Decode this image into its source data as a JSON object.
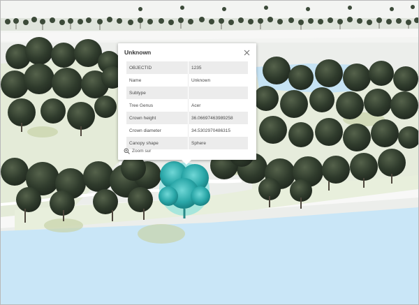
{
  "popup": {
    "title": "Unknown",
    "attributes": [
      {
        "field": "OBJECTID",
        "value": "1235"
      },
      {
        "field": "Name",
        "value": "Unknown"
      },
      {
        "field": "Subtype",
        "value": ""
      },
      {
        "field": "Tree Genus",
        "value": "Acer"
      },
      {
        "field": "Crown height",
        "value": "36.06697463989258"
      },
      {
        "field": "Crown diameter",
        "value": "34.5302970486315"
      },
      {
        "field": "Canopy shape",
        "value": "Sphere"
      }
    ],
    "zoom_label": "Zoom sur"
  },
  "colors": {
    "water": "#c9e6f7",
    "tree": "#2f3b2c",
    "selected_tree": "#1ec9cf",
    "road": "#f4f4f2",
    "grass": "#e3ebd5"
  }
}
